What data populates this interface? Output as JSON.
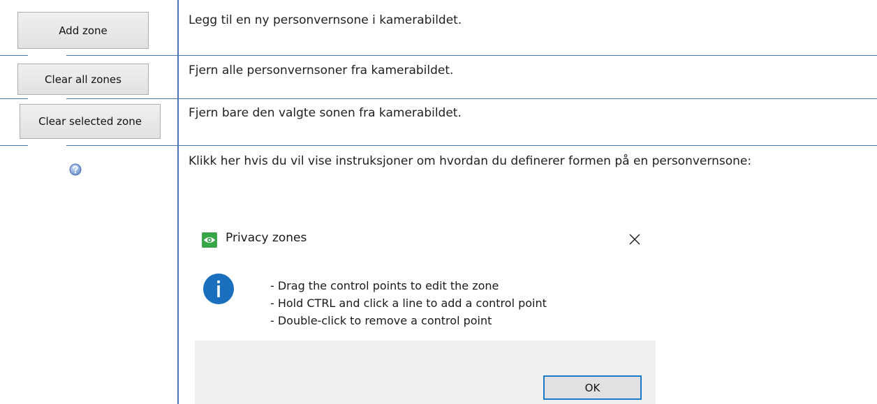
{
  "rows": [
    {
      "button_label": "Add zone",
      "description": "Legg til en ny personvernsone i kamerabildet."
    },
    {
      "button_label": "Clear all zones",
      "description": "Fjern alle personvernsoner fra kamerabildet."
    },
    {
      "button_label": "Clear selected zone",
      "description": "Fjern bare den valgte sonen fra kamerabildet."
    },
    {
      "icon": "help-icon",
      "description": "Klikk her hvis du vil vise instruksjoner om hvordan du definerer formen på en personvernsone:"
    }
  ],
  "dialog": {
    "title": "Privacy zones",
    "logo_icon": "privacy-eye-icon",
    "close_icon": "close-icon",
    "info_icon": "info-icon",
    "messages": [
      "- Drag the control points to edit the zone",
      "- Hold CTRL and click a line to add a control point",
      "- Double-click to remove a control point"
    ],
    "ok_label": "OK"
  },
  "colors": {
    "table_border": "#4a73b8",
    "button_face": "#e1e1e1",
    "button_border": "#adadad",
    "info_blue": "#1a6fbf",
    "logo_green": "#3aa64a",
    "ok_border": "#1979ca",
    "dialog_footer": "#f0f0f0"
  }
}
